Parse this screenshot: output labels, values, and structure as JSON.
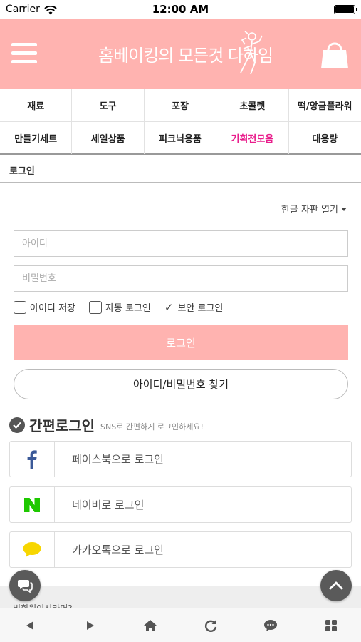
{
  "status_bar": {
    "carrier": "Carrier",
    "time": "12:00 AM"
  },
  "header": {
    "logo_text": "홈베이킹의 모든것 다하임",
    "colors": {
      "background": "#ffb3b0",
      "icons": "#ffffff"
    }
  },
  "categories": {
    "row1": [
      "재료",
      "도구",
      "포장",
      "초콜렛",
      "떡/앙금플라워"
    ],
    "row2": [
      "만들기세트",
      "세일상품",
      "피크닉용품",
      "기획전모음",
      "대용량"
    ],
    "active": "기획전모음",
    "active_color": "#e91e8c"
  },
  "breadcrumb": "로그인",
  "keyboard_toggle": "한글 자판 열기",
  "form": {
    "id_placeholder": "아이디",
    "pw_placeholder": "비밀번호",
    "save_id": "아이디 저장",
    "auto_login": "자동 로그인",
    "secure_login": "보안 로그인",
    "login_button": "로그인",
    "find_button": "아이디/비밀번호 찾기"
  },
  "easy_login": {
    "title": "간편로그인",
    "subtitle": "SNS로 간편하게 로그인하세요!",
    "facebook": "페이스북으로 로그인",
    "naver": "네이버로 로그인",
    "kakao": "카카오톡으로 로그인",
    "colors": {
      "facebook": "#3b5998",
      "naver": "#1ec800",
      "kakao": "#f7d600"
    }
  },
  "footer_band_text": "비회원이시라면?",
  "icons": [
    "wifi-icon",
    "battery-icon",
    "menu-icon",
    "shopping-bag-icon",
    "check-icon",
    "check-circle-icon",
    "facebook-icon",
    "naver-icon",
    "kakao-icon",
    "chat-icon",
    "chevron-up-icon",
    "back-icon",
    "forward-icon",
    "home-icon",
    "refresh-icon",
    "message-icon",
    "grid-icon"
  ]
}
